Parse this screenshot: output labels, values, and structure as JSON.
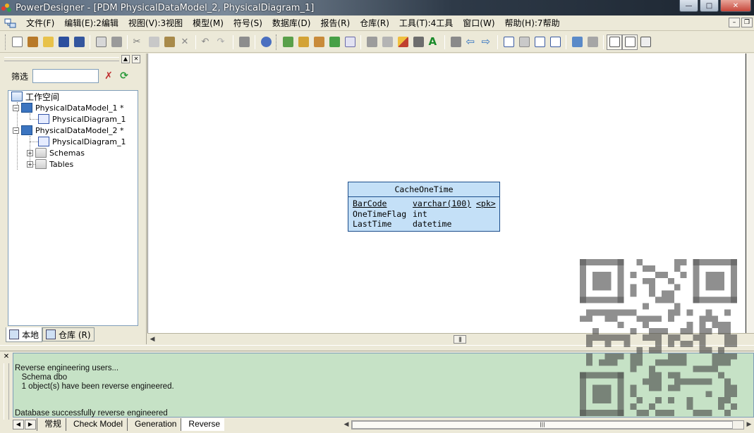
{
  "window": {
    "title": "PowerDesigner - [PDM PhysicalDataModel_2, PhysicalDiagram_1]",
    "min": "—",
    "max": "□",
    "close": "✕"
  },
  "menu": [
    "文件(F)",
    "编辑(E):2编辑",
    "视图(V):3视图",
    "模型(M)",
    "符号(S)",
    "数据库(D)",
    "报告(R)",
    "仓库(R)",
    "工具(T):4工具",
    "窗口(W)",
    "帮助(H):7帮助"
  ],
  "mdi_buttons": {
    "min": "–",
    "restore": "❐"
  },
  "toolbar": {
    "icons": [
      "new-icon",
      "open-project-icon",
      "open-icon",
      "save-icon",
      "save-all-icon",
      "print-preview-icon",
      "print-icon",
      "cut-icon",
      "copy-icon",
      "paste-icon",
      "delete-icon",
      "undo-icon",
      "redo-icon",
      "properties-icon",
      "check-model-icon",
      "new-model-icon",
      "package-icon",
      "list-icon",
      "refresh-icon",
      "check-icon",
      "shape-icon",
      "grey-shape-icon",
      "pencil-icon",
      "fill-icon",
      "font-icon",
      "box-icon",
      "back-arrow-icon",
      "forward-arrow-icon",
      "view-1-icon",
      "view-2-icon",
      "view-3-icon",
      "view-4-icon",
      "zoom-icon",
      "image-icon",
      "browser-toggle-icon",
      "output-toggle-icon",
      "result-list-icon"
    ]
  },
  "browser": {
    "filter_label": "筛选",
    "filter_value": "",
    "tree": {
      "workspace": "工作空间",
      "model1": "PhysicalDataModel_1 *",
      "model1_diagram": "PhysicalDiagram_1",
      "model2": "PhysicalDataModel_2 *",
      "model2_diagram": "PhysicalDiagram_1",
      "schemas": "Schemas",
      "tables": "Tables"
    },
    "tabs": {
      "local": "本地",
      "repository": "仓库 (R)"
    }
  },
  "entity": {
    "name": "CacheOneTime",
    "columns": [
      {
        "name": "BarCode",
        "type": "varchar(100)",
        "key": "<pk>"
      },
      {
        "name": "OneTimeFlag",
        "type": "int",
        "key": ""
      },
      {
        "name": "LastTime",
        "type": "datetime",
        "key": ""
      }
    ]
  },
  "output": {
    "lines": [
      "Reverse engineering users...",
      "   Schema dbo",
      "   1 object(s) have been reverse engineered.",
      "",
      "Database successfully reverse engineered"
    ],
    "tabs": [
      "常规",
      "Check Model",
      "Generation",
      "Reverse"
    ]
  },
  "colors": {
    "entity_fill": "#c4e0f7",
    "entity_border": "#1a4c8a",
    "output_bg": "#c6e2c6"
  }
}
